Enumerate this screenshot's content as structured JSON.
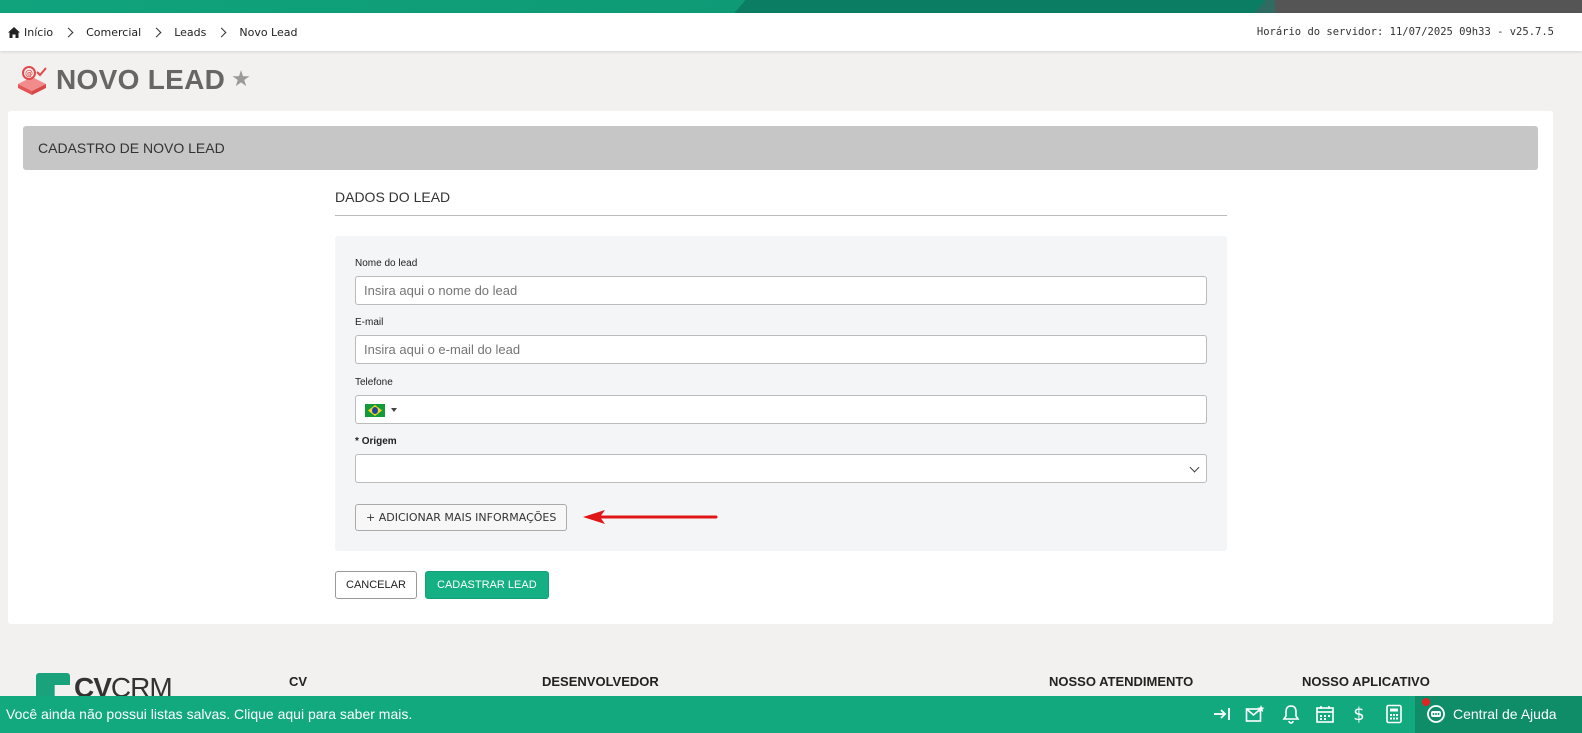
{
  "breadcrumb": {
    "items": [
      "Início",
      "Comercial",
      "Leads",
      "Novo Lead"
    ]
  },
  "server_time": "Horário do servidor: 11/07/2025 09h33 - v25.7.5",
  "page": {
    "title": "NOVO LEAD"
  },
  "card": {
    "header": "CADASTRO DE NOVO LEAD",
    "section_title": "DADOS DO LEAD"
  },
  "form": {
    "name": {
      "label": "Nome do lead",
      "placeholder": "Insira aqui o nome do lead",
      "value": ""
    },
    "email": {
      "label": "E-mail",
      "placeholder": "Insira aqui o e-mail do lead",
      "value": ""
    },
    "phone": {
      "label": "Telefone",
      "country": "Brazil",
      "value": ""
    },
    "origin": {
      "required_mark": "*",
      "label": "Origem",
      "value": ""
    },
    "more_button": "+ ADICIONAR MAIS INFORMAÇÕES"
  },
  "actions": {
    "cancel": "CANCELAR",
    "submit": "CADASTRAR LEAD"
  },
  "footer": {
    "logo_bold": "CV",
    "logo_light": "CRM",
    "columns": [
      "CV",
      "DESENVOLVEDOR",
      "NOSSO ATENDIMENTO",
      "NOSSO APLICATIVO"
    ]
  },
  "statusbar": {
    "message": "Você ainda não possui listas salvas. Clique aqui para saber mais.",
    "help_label": "Central de Ajuda",
    "icons": [
      "collapse-right-icon",
      "mail-star-icon",
      "bell-icon",
      "calendar-icon",
      "dollar-icon",
      "calculator-icon",
      "chat-icon"
    ]
  },
  "colors": {
    "brand_green": "#14b083",
    "header_gray": "#c6c6c6",
    "arrow_red": "#e01616"
  }
}
